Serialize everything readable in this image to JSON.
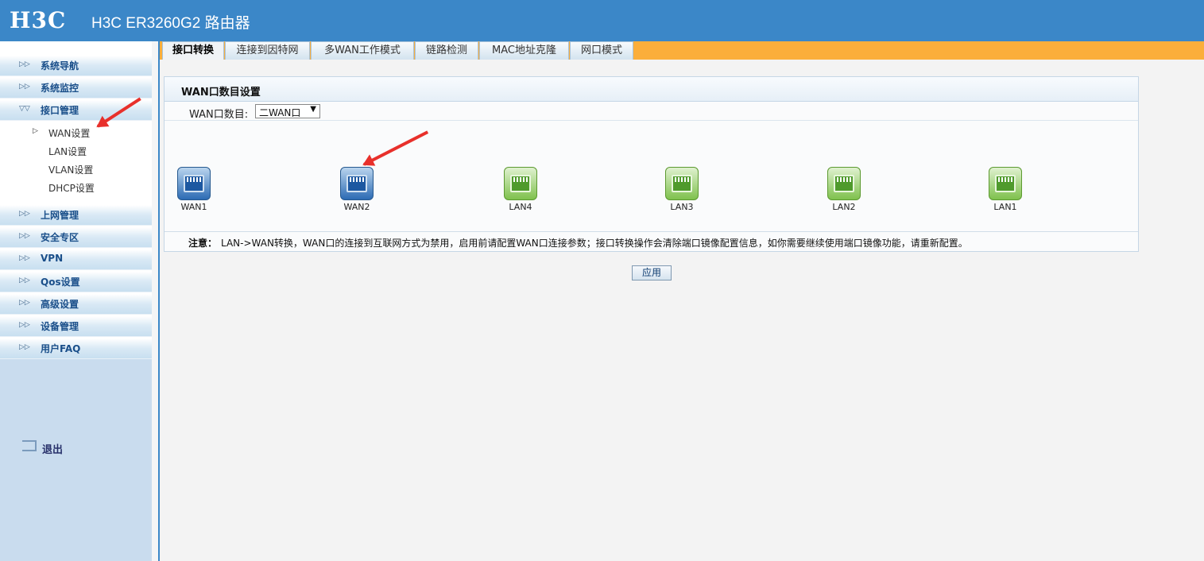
{
  "header": {
    "logo": "H3C",
    "title": "H3C ER3260G2 路由器"
  },
  "sidebar": {
    "items": [
      {
        "label": "系统导航"
      },
      {
        "label": "系统监控"
      },
      {
        "label": "接口管理"
      },
      {
        "label": "上网管理"
      },
      {
        "label": "安全专区"
      },
      {
        "label": "VPN"
      },
      {
        "label": "Qos设置"
      },
      {
        "label": "高级设置"
      },
      {
        "label": "设备管理"
      },
      {
        "label": "用户FAQ"
      }
    ],
    "subitems": [
      {
        "label": "WAN设置",
        "selected": true
      },
      {
        "label": "LAN设置"
      },
      {
        "label": "VLAN设置"
      },
      {
        "label": "DHCP设置"
      }
    ],
    "logout": "退出"
  },
  "tabs": [
    {
      "label": "接口转换",
      "active": true
    },
    {
      "label": "连接到因特网"
    },
    {
      "label": "多WAN工作模式"
    },
    {
      "label": "链路检测"
    },
    {
      "label": "MAC地址克隆"
    },
    {
      "label": "网口模式"
    }
  ],
  "panel": {
    "title": "WAN口数目设置",
    "wan_count_label": "WAN口数目:",
    "wan_count_value": "二WAN口",
    "ports": [
      {
        "label": "WAN1",
        "type": "wan"
      },
      {
        "label": "WAN2",
        "type": "wan"
      },
      {
        "label": "LAN4",
        "type": "lan"
      },
      {
        "label": "LAN3",
        "type": "lan"
      },
      {
        "label": "LAN2",
        "type": "lan"
      },
      {
        "label": "LAN1",
        "type": "lan"
      }
    ],
    "notice_label": "注意：",
    "notice_text": "LAN->WAN转换，WAN口的连接到互联网方式为禁用，启用前请配置WAN口连接参数；接口转换操作会清除端口镜像配置信息，如你需要继续使用端口镜像功能，请重新配置。"
  },
  "apply_label": "应用",
  "colors": {
    "header_bg": "#3b87c8",
    "tabbar_bg": "#fbae3b",
    "wan_port": "#2c6bb4",
    "lan_port": "#7fc14d",
    "annotation_arrow": "#e8302b"
  }
}
